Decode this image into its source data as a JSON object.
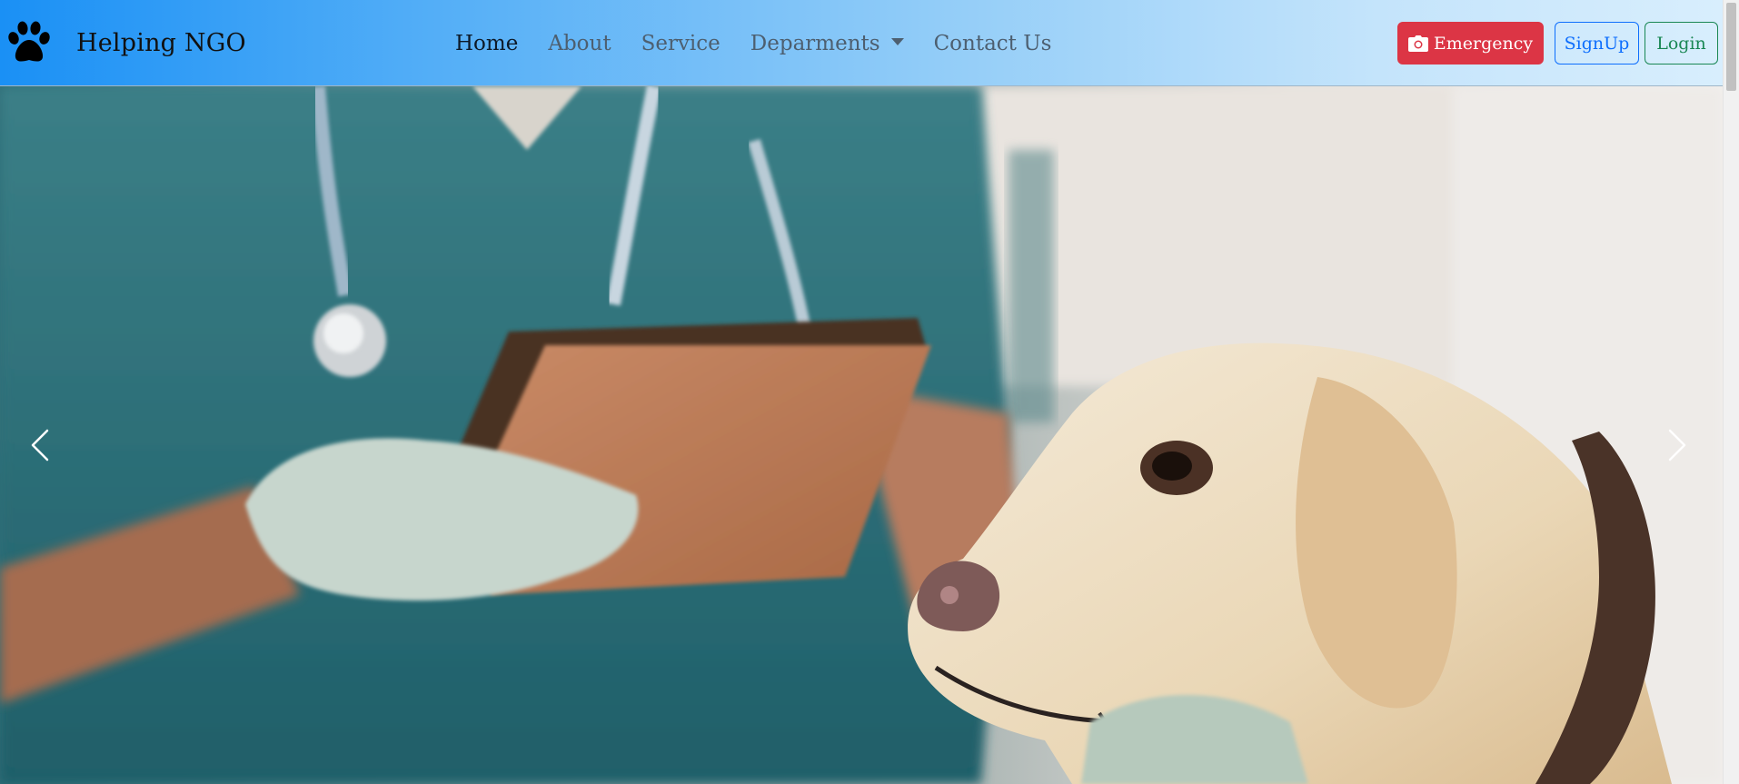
{
  "brand": {
    "name": "Helping NGO",
    "logo_icon": "paw-icon"
  },
  "nav": {
    "items": [
      {
        "label": "Home",
        "active": true
      },
      {
        "label": "About",
        "active": false
      },
      {
        "label": "Service",
        "active": false
      },
      {
        "label": "Deparments",
        "active": false,
        "dropdown": true
      },
      {
        "label": "Contact Us",
        "active": false
      }
    ]
  },
  "actions": {
    "emergency_label": "Emergency",
    "emergency_icon": "camera-icon",
    "signup_label": "SignUp",
    "login_label": "Login"
  },
  "carousel": {
    "prev_icon": "chevron-left-icon",
    "next_icon": "chevron-right-icon"
  },
  "colors": {
    "navbar_gradient_start": "#1a90f5",
    "navbar_gradient_end": "#d8eefd",
    "emergency": "#dc3545",
    "signup": "#0d6efd",
    "login": "#198754",
    "nav_active": "#0d1a28",
    "nav_inactive": "#4d5f70"
  }
}
